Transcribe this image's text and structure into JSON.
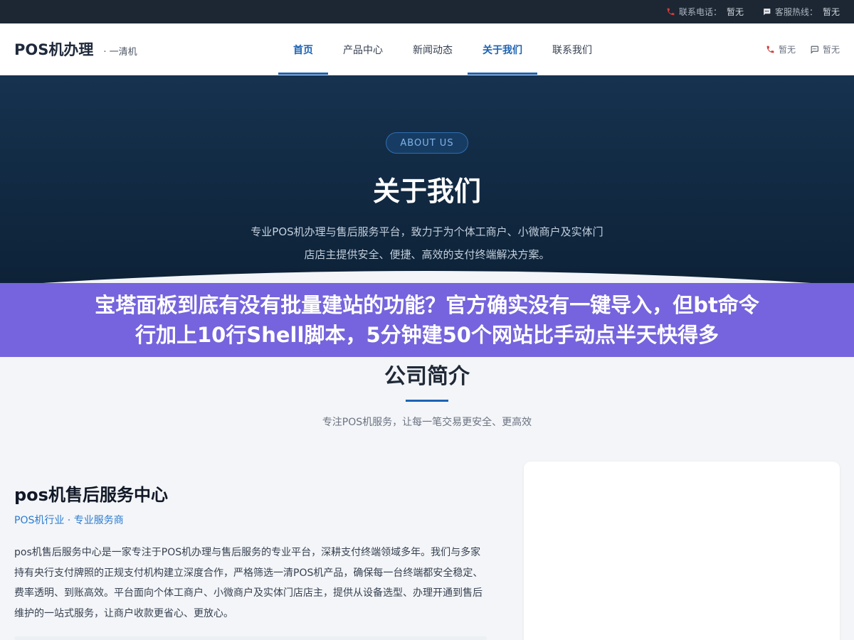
{
  "topbar": {
    "phone_label": "联系电话：",
    "phone_value": "暂无",
    "hotline_label": "客服热线：",
    "hotline_value": "暂无"
  },
  "header": {
    "brand_name": "POS机办理",
    "brand_sub": "· 一清机",
    "nav": [
      "首页",
      "产品中心",
      "新闻动态",
      "关于我们",
      "联系我们"
    ],
    "right_phone": "暂无",
    "right_chat": "暂无"
  },
  "hero": {
    "badge": "ABOUT US",
    "title": "关于我们",
    "desc_line1": "专业POS机办理与售后服务平台，致力于为个体工商户、小微商户及实体门",
    "desc_line2": "店店主提供安全、便捷、高效的支付终端解决方案。"
  },
  "promo": {
    "line1": "宝塔面板到底有没有批量建站的功能？官方确实没有一键导入，但bt命令",
    "line2": "行加上10行Shell脚本，5分钟建50个网站比手动点半天快得多"
  },
  "intro": {
    "title": "公司简介",
    "subtitle": "专注POS机服务，让每一笔交易更安全、更高效"
  },
  "company": {
    "name": "pos机售后服务中心",
    "tag": "POS机行业 · 专业服务商",
    "desc": "pos机售后服务中心是一家专注于POS机办理与售后服务的专业平台，深耕支付终端领域多年。我们与多家持有央行支付牌照的正规支付机构建立深度合作，严格筛选一清POS机产品，确保每一台终端都安全稳定、费率透明、到账高效。平台面向个体工商户、小微商户及实体门店店主，提供从设备选型、办理开通到售后维护的一站式服务，让商户收款更省心、更放心。"
  },
  "colors": {
    "accent": "#1d63b4",
    "promo_bg": "#7564dd",
    "hero_bg": "#16324f",
    "topbar_bg": "#1c2733",
    "phone_icon": "#d63b3b"
  }
}
